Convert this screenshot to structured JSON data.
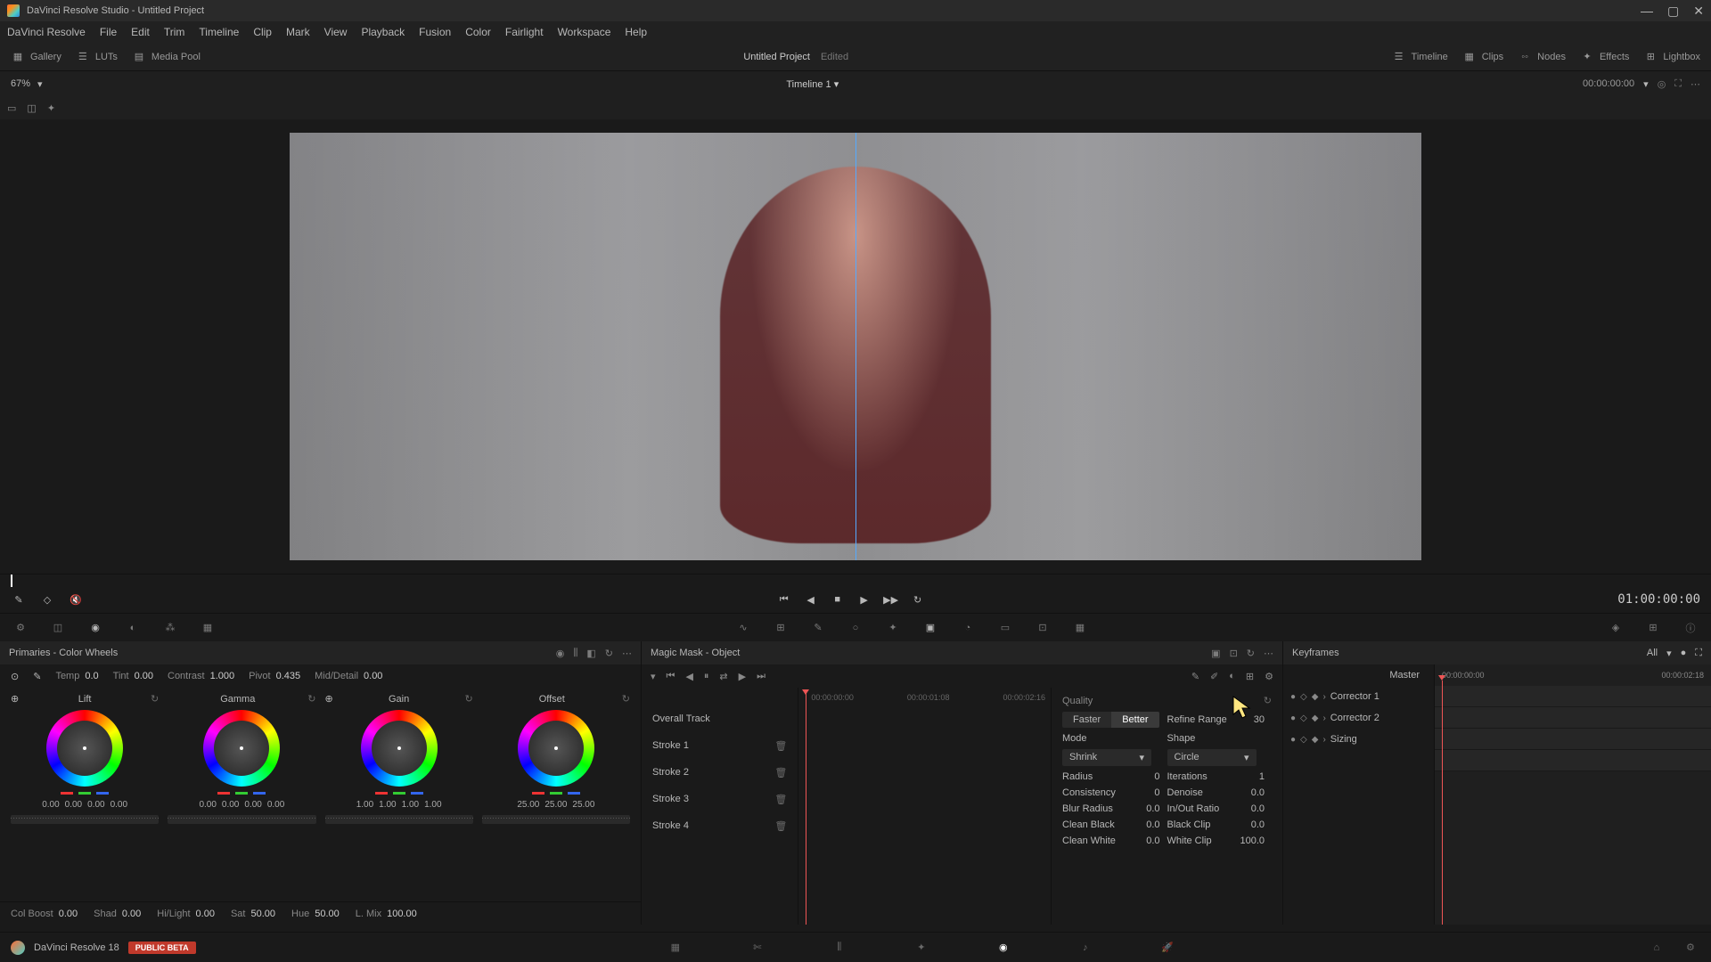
{
  "window": {
    "title": "DaVinci Resolve Studio - Untitled Project"
  },
  "menus": [
    "DaVinci Resolve",
    "File",
    "Edit",
    "Trim",
    "Timeline",
    "Clip",
    "Mark",
    "View",
    "Playback",
    "Fusion",
    "Color",
    "Fairlight",
    "Workspace",
    "Help"
  ],
  "topbar": {
    "gallery": "Gallery",
    "luts": "LUTs",
    "mediapool": "Media Pool",
    "project": "Untitled Project",
    "edited": "Edited",
    "timeline": "Timeline",
    "clips": "Clips",
    "nodes": "Nodes",
    "effects": "Effects",
    "lightbox": "Lightbox"
  },
  "subbar": {
    "zoom": "67%",
    "timeline_name": "Timeline 1",
    "timecode": "00:00:00:00"
  },
  "transport": {
    "right_tc": "01:00:00:00"
  },
  "primaries": {
    "title": "Primaries - Color Wheels",
    "temp_label": "Temp",
    "temp_val": "0.0",
    "tint_label": "Tint",
    "tint_val": "0.00",
    "contrast_label": "Contrast",
    "contrast_val": "1.000",
    "pivot_label": "Pivot",
    "pivot_val": "0.435",
    "mid_label": "Mid/Detail",
    "mid_val": "0.00",
    "wheels": {
      "lift": {
        "label": "Lift",
        "v": [
          "0.00",
          "0.00",
          "0.00",
          "0.00"
        ]
      },
      "gamma": {
        "label": "Gamma",
        "v": [
          "0.00",
          "0.00",
          "0.00",
          "0.00"
        ]
      },
      "gain": {
        "label": "Gain",
        "v": [
          "1.00",
          "1.00",
          "1.00",
          "1.00"
        ]
      },
      "offset": {
        "label": "Offset",
        "v": [
          "25.00",
          "25.00",
          "25.00"
        ]
      }
    },
    "bottom": {
      "colboost_l": "Col Boost",
      "colboost": "0.00",
      "shad_l": "Shad",
      "shad": "0.00",
      "hilight_l": "Hi/Light",
      "hilight": "0.00",
      "sat_l": "Sat",
      "sat": "50.00",
      "hue_l": "Hue",
      "hue": "50.00",
      "lmix_l": "L. Mix",
      "lmix": "100.00"
    }
  },
  "magic": {
    "title": "Magic Mask - Object",
    "overall": "Overall Track",
    "strokes": [
      "Stroke 1",
      "Stroke 2",
      "Stroke 3",
      "Stroke 4"
    ],
    "tc": [
      "00:00:00:00",
      "00:00:01:08",
      "00:00:02:16"
    ],
    "quality_label": "Quality",
    "faster": "Faster",
    "better": "Better",
    "mode_label": "Mode",
    "mode_val": "Shrink",
    "shape_label": "Shape",
    "shape_val": "Circle",
    "refine_l": "Refine Range",
    "refine_v": "30",
    "radius_l": "Radius",
    "radius_v": "0",
    "iter_l": "Iterations",
    "iter_v": "1",
    "consist_l": "Consistency",
    "consist_v": "0",
    "denoise_l": "Denoise",
    "denoise_v": "0.0",
    "blur_l": "Blur Radius",
    "blur_v": "0.0",
    "inout_l": "In/Out Ratio",
    "inout_v": "0.0",
    "cblack_l": "Clean Black",
    "cblack_v": "0.0",
    "bclip_l": "Black Clip",
    "bclip_v": "0.0",
    "cwhite_l": "Clean White",
    "cwhite_v": "0.0",
    "wclip_l": "White Clip",
    "wclip_v": "100.0"
  },
  "keyframes": {
    "title": "Keyframes",
    "all": "All",
    "tc_start": "00:00:00:00",
    "tc_end": "00:00:02:18",
    "master": "Master",
    "tracks": [
      "Corrector 1",
      "Corrector 2",
      "Sizing"
    ]
  },
  "footer": {
    "version": "DaVinci Resolve 18",
    "beta": "PUBLIC BETA"
  }
}
